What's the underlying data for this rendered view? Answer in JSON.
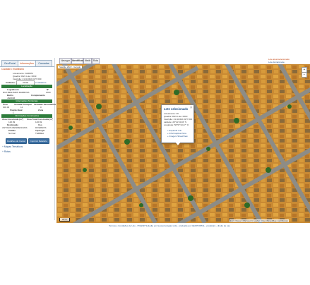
{
  "left_panel": {
    "tabs": [
      "GeoPortal",
      "Informações",
      "Camadas"
    ],
    "active_tab": 1,
    "cadastro_header": "Cadastro Imobiliário",
    "lines": [
      "Loteamento: JARDIM",
      "Quadra: 0021  Lote: 0019",
      "Inscrição: 21.02.002.0177.000"
    ],
    "cadastro_label": "Cadastro:",
    "cadastro_value": "70202",
    "cadastros_link": "2 cadastros",
    "sec_localizacao": "Localização",
    "logradouro_label": "Logradouro",
    "numero_label": "Nº",
    "logradouro_value": "RUA BENJAMIN BARBOSA",
    "numero_value": "1000",
    "bairro_label": "Bairro",
    "complemento_label": "Complemento",
    "bairro_value": "JARDIM",
    "sec_informacoes": "Informações Territoriais",
    "area_terreno_label": "Área",
    "testada_label": "Testada Principal",
    "testadas_label": "Testadas Secundárias",
    "area_terreno_value": "300.00",
    "testada_value": "12",
    "testadas_value": "0",
    "fracao_label": "Fração Ideal",
    "zona_label": "Zona",
    "fracao_value": "1",
    "sec_construcoes": "Informações Construções",
    "area_construida_label": "Área Construída (m²)",
    "area_total_label": "Área Total Construída (m²)",
    "area_construida_value": "126.69",
    "area_total_value": "126.69",
    "destinacao_label": "Destinação",
    "uso_label": "Uso",
    "destinacao_value": "ANTIGOS RESIDENCIAIS",
    "uso_value": "DIVERSOS",
    "tipologia_label": "Padrão",
    "tipo_label": "Tipologia",
    "tipologia_value": "Normal",
    "tipo_value": "TERREA",
    "btn_detalhes": "Detalhes do Imóvel",
    "btn_relatorio": "Imprimir Relatório",
    "links": [
      "+ Mapas Temáticos",
      "+ Rotas"
    ]
  },
  "map": {
    "tabs": [
      "Navegar",
      "Identificar",
      "Medir",
      "Rota"
    ],
    "active_tab": 1,
    "layer_label": "Satélite 2022 - Gerado",
    "right_legend": [
      "Lote atual selecionado",
      "Lote demais sele."
    ],
    "popup": {
      "title": "Lote selecionado",
      "close": "×",
      "lines": [
        "Loteamento: 49",
        "Quadra: 0021  Lote: 0019",
        "Inscrição: 21.02.002.0177.000",
        "Latitude: 20°11'13.94\" S",
        "Longitude: 50°57'13.27\" O"
      ],
      "links": [
        "+ Expandir Info",
        "+ Informações Zona",
        "+ Imagem StreetView"
      ]
    },
    "attribution": "Esri | Maxar | Microsoft | Leaflet | OpenStreetMap contributors",
    "scale_label": "20 m"
  },
  "footer": {
    "text": "Termos e Condições de Uso - ITGESP Solução em Geotecnologias Ltda - produção por GEOPORTAL - prefeitura - direito de uso"
  },
  "colors": {
    "accent_green": "#2f7d3d",
    "header_orange": "#c2410c",
    "link_blue": "#1f4f86"
  }
}
